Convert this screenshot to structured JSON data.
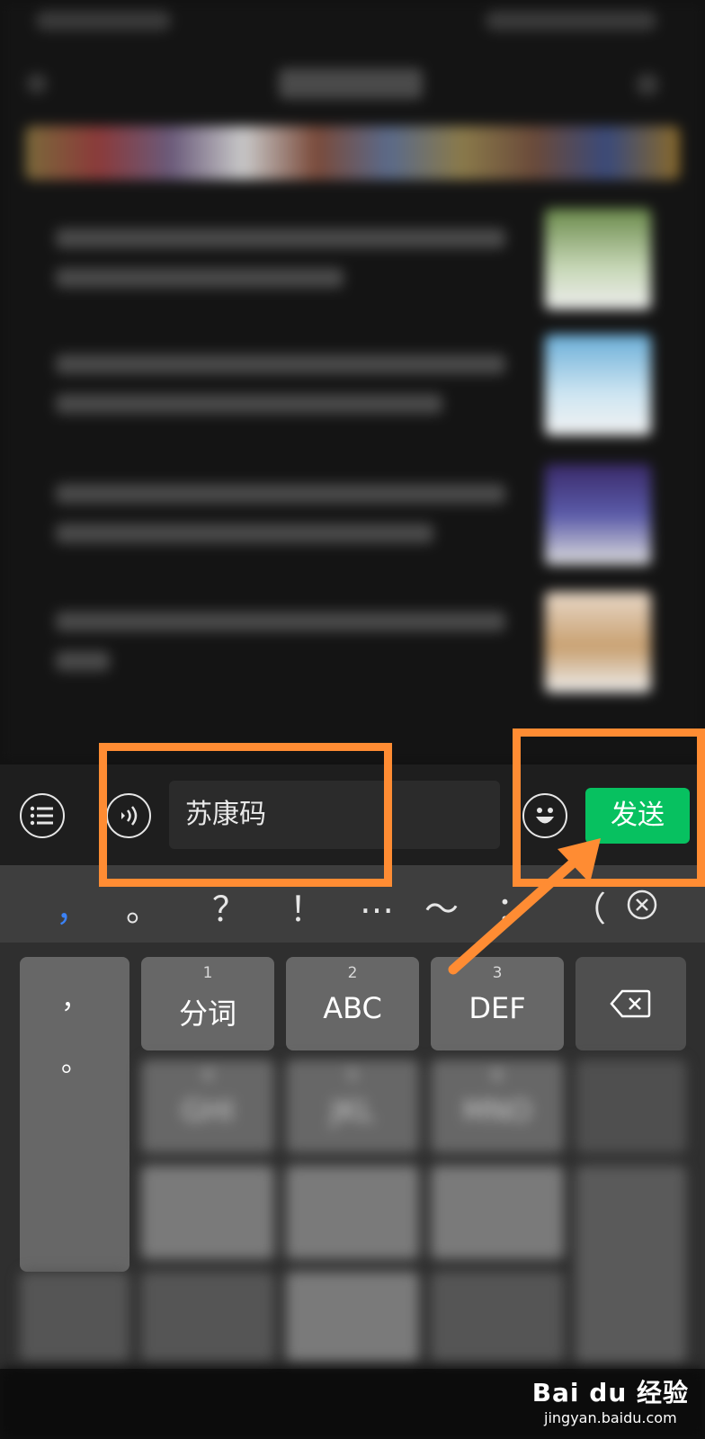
{
  "input_bar": {
    "message_text": "苏康码",
    "send_label": "发送"
  },
  "keyboard": {
    "punctuation": [
      "，",
      "。",
      "？",
      "！",
      "…",
      "～",
      "：",
      "（"
    ],
    "side_column": [
      "，",
      "。"
    ],
    "keys": [
      {
        "num": "1",
        "label": "分词"
      },
      {
        "num": "2",
        "label": "ABC"
      },
      {
        "num": "3",
        "label": "DEF"
      },
      {
        "num": "4",
        "label": "GHI"
      },
      {
        "num": "5",
        "label": "JKL"
      },
      {
        "num": "6",
        "label": "MNO"
      }
    ]
  },
  "watermark": {
    "brand": "Bai du 经验",
    "url": "jingyan.baidu.com"
  },
  "colors": {
    "send_green": "#07c160",
    "annotation_orange": "#ff8c33"
  }
}
